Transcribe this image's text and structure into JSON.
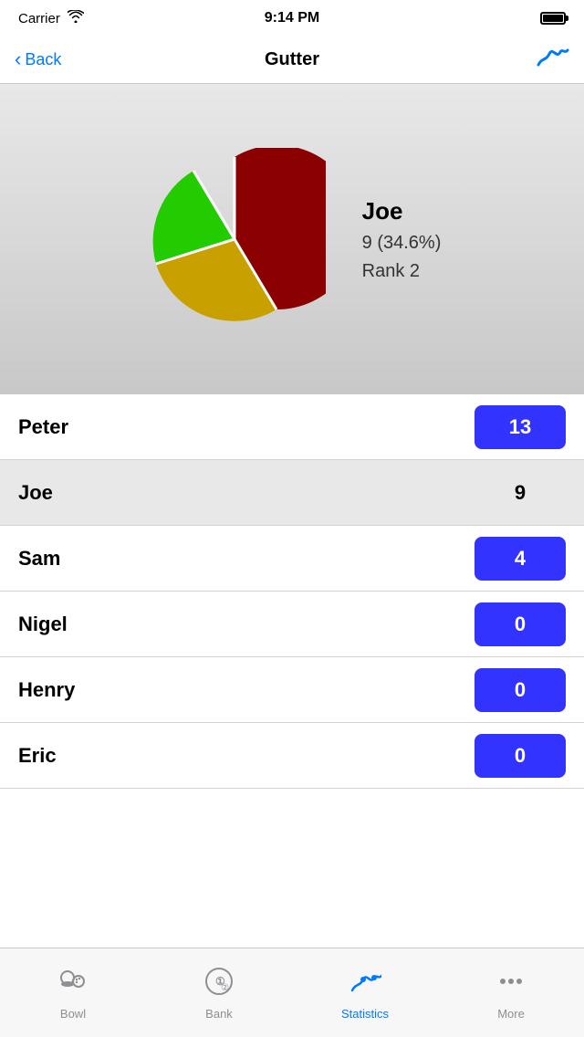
{
  "statusBar": {
    "carrier": "Carrier",
    "time": "9:14 PM"
  },
  "navBar": {
    "backLabel": "Back",
    "title": "Gutter"
  },
  "chartSection": {
    "playerName": "Joe",
    "scoreText": "9 (34.6%)",
    "rankText": "Rank 2",
    "pieSlices": [
      {
        "color": "#8b0000",
        "percent": 50,
        "startAngle": 270,
        "endAngle": 450
      },
      {
        "color": "#ccaa00",
        "percent": 30,
        "startAngle": 450,
        "endAngle": 558
      },
      {
        "color": "#22bb00",
        "percent": 13,
        "startAngle": 558,
        "endAngle": 605
      }
    ]
  },
  "players": [
    {
      "name": "Peter",
      "score": "13",
      "highlighted": false,
      "badge": true
    },
    {
      "name": "Joe",
      "score": "9",
      "highlighted": true,
      "badge": false
    },
    {
      "name": "Sam",
      "score": "4",
      "highlighted": false,
      "badge": true
    },
    {
      "name": "Nigel",
      "score": "0",
      "highlighted": false,
      "badge": true
    },
    {
      "name": "Henry",
      "score": "0",
      "highlighted": false,
      "badge": true
    },
    {
      "name": "Eric",
      "score": "0",
      "highlighted": false,
      "badge": true
    }
  ],
  "tabBar": {
    "items": [
      {
        "id": "bowl",
        "label": "Bowl",
        "active": false
      },
      {
        "id": "bank",
        "label": "Bank",
        "active": false
      },
      {
        "id": "statistics",
        "label": "Statistics",
        "active": true
      },
      {
        "id": "more",
        "label": "More",
        "active": false
      }
    ]
  }
}
